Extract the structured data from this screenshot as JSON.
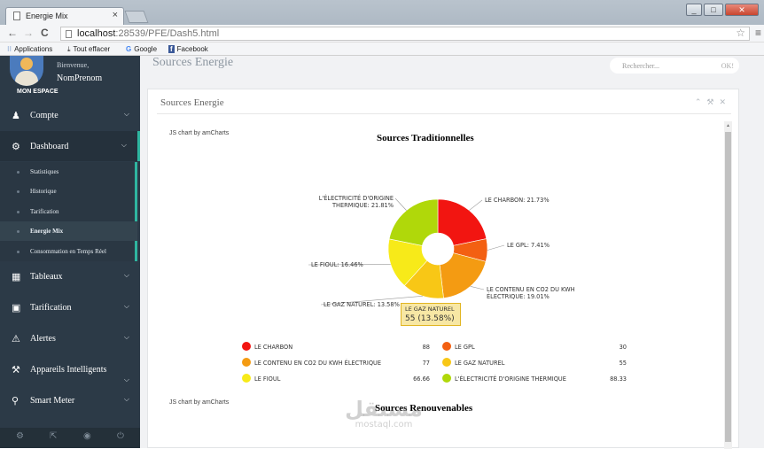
{
  "browser": {
    "tab_title": "Energie Mix",
    "tab_close": "×",
    "url_host": "localhost",
    "url_path": ":28539/PFE/Dash5.html",
    "bookmarks": [
      "Applications",
      "Tout effacer",
      "Google",
      "Facebook"
    ]
  },
  "sidebar": {
    "welcome": "Bienvenue,",
    "username": "NomPrenom",
    "section": "MON ESPACE",
    "items": [
      {
        "label": "Compte",
        "icon": "user-icon"
      },
      {
        "label": "Dashboard",
        "icon": "dashboard-icon"
      },
      {
        "label": "Tableaux",
        "icon": "table-icon"
      },
      {
        "label": "Tarification",
        "icon": "money-icon"
      },
      {
        "label": "Alertes",
        "icon": "warning-icon"
      },
      {
        "label": "Appareils Intelligents",
        "icon": "wrench-icon"
      },
      {
        "label": "Smart Meter",
        "icon": "map-marker-icon"
      }
    ],
    "subitems": [
      "Statistiques",
      "Historique",
      "Tarification",
      "Energie Mix",
      "Consommation en Temps Réel"
    ],
    "current_subitem": "Energie Mix"
  },
  "header": {
    "page_title": "Sources Energie",
    "search_placeholder": "Rechercher...",
    "search_button": "OK!"
  },
  "panel": {
    "title": "Sources Energie",
    "credit": "JS chart by amCharts"
  },
  "tooltip": {
    "label": "LE GAZ NATUREL",
    "value": "55 (13.58%)"
  },
  "watermark": {
    "arabic": "مستقل",
    "latin": "mostaql.com"
  },
  "chart_data": [
    {
      "type": "pie",
      "title": "Sources Traditionnelles",
      "donut": true,
      "slices": [
        {
          "label": "LE CHARBON",
          "value": 88,
          "percent": "21.73%",
          "color": "#f21511"
        },
        {
          "label": "LE GPL",
          "value": 30,
          "percent": "7.41%",
          "color": "#f36012"
        },
        {
          "label": "LE CONTENU EN CO2 DU KWH ÉLECTRIQUE",
          "value": 77,
          "percent": "19.01%",
          "color": "#f49b12"
        },
        {
          "label": "LE GAZ NATUREL",
          "value": 55,
          "percent": "13.58%",
          "color": "#f8c716"
        },
        {
          "label": "LE FIOUL",
          "value": 66.66,
          "percent": "16.46%",
          "color": "#f7ea19"
        },
        {
          "label": "L'ÉLECTRICITÉ D'ORIGINE THERMIQUE",
          "value": 88.33,
          "percent": "21.81%",
          "color": "#b0d80a"
        }
      ]
    },
    {
      "type": "pie",
      "title": "Sources Renouvenables",
      "slices": []
    }
  ]
}
